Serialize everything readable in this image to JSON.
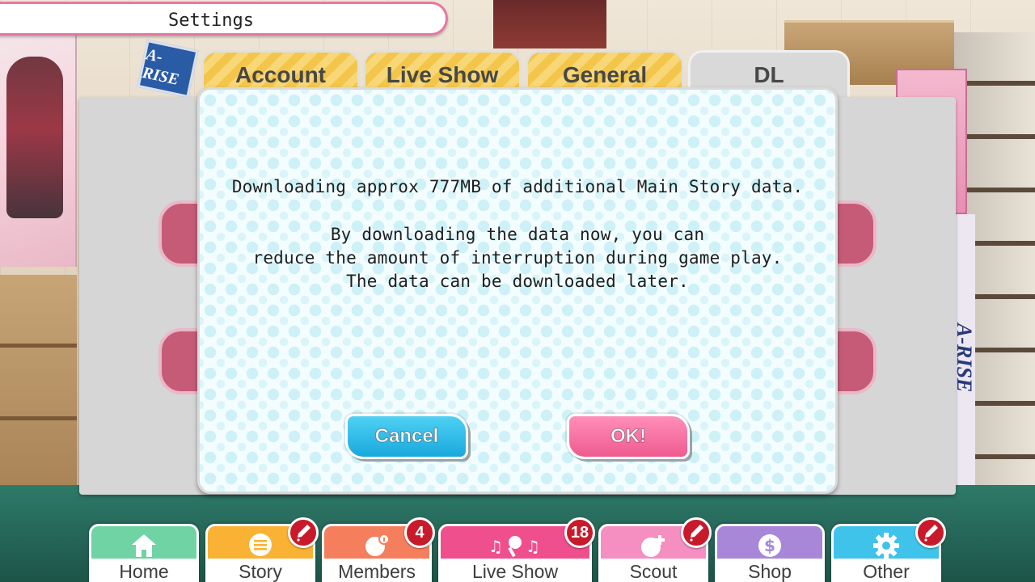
{
  "header": {
    "title": "Settings"
  },
  "tabs": [
    {
      "label": "Account"
    },
    {
      "label": "Live Show"
    },
    {
      "label": "General"
    },
    {
      "label": "DL",
      "active": true
    }
  ],
  "dialog": {
    "line1": "Downloading approx 777MB of additional Main Story data.",
    "line2": "By downloading the data now, you can",
    "line3": "reduce the amount of interruption during game play.",
    "line4": "The data can be downloaded later.",
    "cancel_label": "Cancel",
    "ok_label": "OK!"
  },
  "background": {
    "left_sign_text": "A-RISE",
    "right_banner_text": "A-RISE"
  },
  "nav": {
    "items": [
      {
        "label": "Home",
        "icon": "home-icon",
        "color": "#6fd3a4"
      },
      {
        "label": "Story",
        "icon": "story-icon",
        "color": "#f9b233",
        "badge": "!"
      },
      {
        "label": "Members",
        "icon": "members-icon",
        "color": "#f57f5c",
        "badge": "4"
      },
      {
        "label": "Live Show",
        "icon": "live-show-icon",
        "color": "#ef4f8d",
        "badge": "18"
      },
      {
        "label": "Scout",
        "icon": "scout-icon",
        "color": "#f58fc2",
        "badge": "!"
      },
      {
        "label": "Shop",
        "icon": "shop-icon",
        "color": "#a887d9"
      },
      {
        "label": "Other",
        "icon": "gear-icon",
        "color": "#3fc3ea",
        "badge": "!"
      }
    ]
  },
  "colors": {
    "accent_pink": "#e777a4",
    "cancel_blue": "#19a9de",
    "ok_pink": "#ef5a8f",
    "badge_red": "#c81a2b"
  }
}
